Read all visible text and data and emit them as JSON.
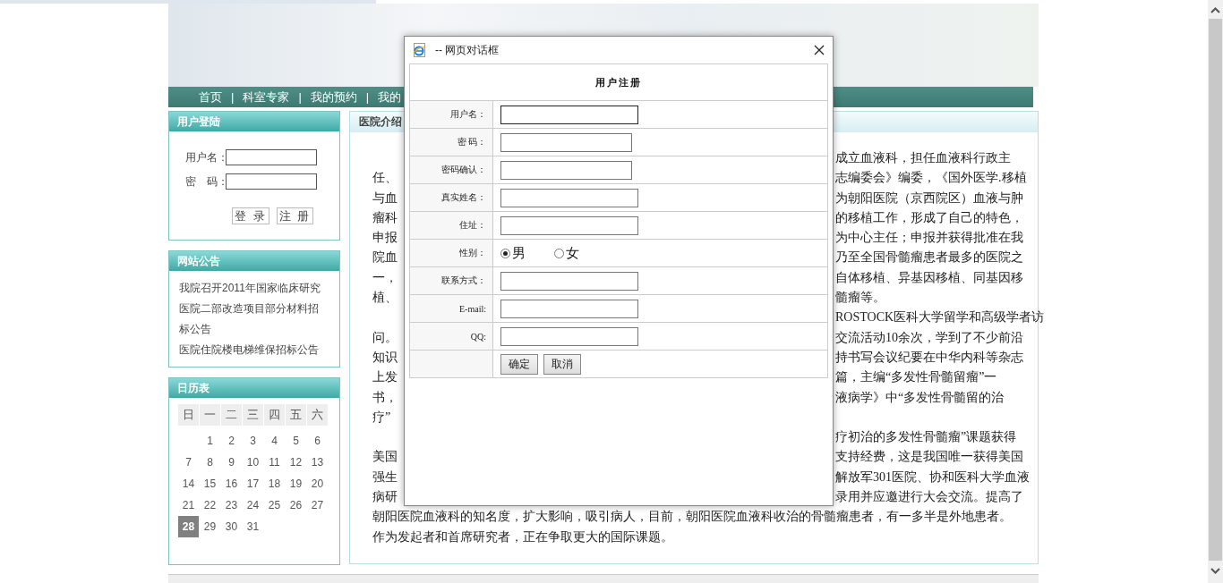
{
  "nav": [
    {
      "kind": "link",
      "label": "首页"
    },
    {
      "kind": "separator",
      "label": "|"
    },
    {
      "kind": "link",
      "label": "科室专家"
    },
    {
      "kind": "separator",
      "label": "|"
    },
    {
      "kind": "link",
      "label": "我的预约"
    },
    {
      "kind": "separator",
      "label": "|"
    },
    {
      "kind": "link",
      "label": "我的"
    }
  ],
  "login": {
    "title": "用户登陆",
    "fields": [
      {
        "label": "用户名："
      },
      {
        "label": "密　码："
      }
    ],
    "buttons": [
      "登 录",
      "注 册"
    ]
  },
  "notices": {
    "title": "网站公告",
    "items": [
      "我院召开2011年国家临床研究",
      "医院二部改造项目部分材料招标公告",
      "医院住院楼电梯维保招标公告"
    ]
  },
  "calendar": {
    "title": "日历表",
    "weekdays": [
      "日",
      "一",
      "二",
      "三",
      "四",
      "五",
      "六"
    ],
    "weeks": [
      {
        "days": [
          {
            "day": "1",
            "selected": false
          },
          {
            "day": "2",
            "selected": false
          },
          {
            "day": "3",
            "selected": false
          },
          {
            "day": "4",
            "selected": false
          },
          {
            "day": "5",
            "selected": false
          },
          {
            "day": "6",
            "selected": false
          }
        ]
      },
      {
        "days": [
          {
            "day": "7",
            "selected": false
          },
          {
            "day": "8",
            "selected": false
          },
          {
            "day": "9",
            "selected": false
          },
          {
            "day": "10",
            "selected": false
          },
          {
            "day": "11",
            "selected": false
          },
          {
            "day": "12",
            "selected": false
          },
          {
            "day": "13",
            "selected": false
          }
        ]
      },
      {
        "days": [
          {
            "day": "14",
            "selected": false
          },
          {
            "day": "15",
            "selected": false
          },
          {
            "day": "16",
            "selected": false
          },
          {
            "day": "17",
            "selected": false
          },
          {
            "day": "18",
            "selected": false
          },
          {
            "day": "19",
            "selected": false
          },
          {
            "day": "20",
            "selected": false
          }
        ]
      },
      {
        "days": [
          {
            "day": "21",
            "selected": false
          },
          {
            "day": "22",
            "selected": false
          },
          {
            "day": "23",
            "selected": false
          },
          {
            "day": "24",
            "selected": false
          },
          {
            "day": "25",
            "selected": false
          },
          {
            "day": "26",
            "selected": false
          },
          {
            "day": "27",
            "selected": false
          }
        ]
      },
      {
        "days": [
          {
            "day": "28",
            "selected": true
          },
          {
            "day": "29",
            "selected": false
          },
          {
            "day": "30",
            "selected": false
          },
          {
            "day": "31",
            "selected": false
          }
        ]
      }
    ]
  },
  "article": {
    "title": "医院介绍",
    "lines": [
      {
        "kind": "split",
        "end": "成立血液科，担任血液科行政主"
      },
      {
        "kind": "split",
        "start": "任、",
        "end": "志编委会》编委，《国外医学.移植"
      },
      {
        "kind": "split",
        "start": "与血",
        "end": "为朝阳医院（京西院区）血液与肿"
      },
      {
        "kind": "split",
        "start": "瘤科",
        "end": "的移植工作，形成了自己的特色，"
      },
      {
        "kind": "split",
        "start": "申报",
        "end": "为中心主任；申报并获得批准在我"
      },
      {
        "kind": "split",
        "start": "院血",
        "end": "乃至全国骨髓瘤患者最多的医院之"
      },
      {
        "kind": "split",
        "start": "一，",
        "end": "自体移植、异基因移植、同基因移"
      },
      {
        "kind": "split",
        "start": "植、",
        "end": "髓瘤等。"
      },
      {
        "kind": "split",
        "end": "ROSTOCK医科大学留学和高级学者访"
      },
      {
        "kind": "split",
        "start": "问。",
        "end": "交流活动10余次，学到了不少前沿"
      },
      {
        "kind": "split",
        "start": "知识",
        "end": "持书写会议纪要在中华内科等杂志"
      },
      {
        "kind": "split",
        "start": "上发",
        "end": "篇，主编“多发性骨髓留瘤”一"
      },
      {
        "kind": "split",
        "start": "书，",
        "end": "液病学》中“多发性骨髓留的治"
      },
      {
        "kind": "split",
        "start": "疗”"
      },
      {
        "kind": "split",
        "end": "疗初治的多发性骨髓瘤”课题获得"
      },
      {
        "kind": "split",
        "start": "美国",
        "end": "支持经费，这是我国唯一获得美国"
      },
      {
        "kind": "split",
        "start": "强生",
        "end": "解放军301医院、协和医科大学血液"
      },
      {
        "kind": "split",
        "start": "病研",
        "end": "录用并应邀进行大会交流。提高了"
      },
      {
        "kind": "full",
        "text": "朝阳医院血液科的知名度，扩大影响，吸引病人，目前，朝阳医院血液科收治的骨髓瘤患者，有一多半是外地患者。"
      },
      {
        "kind": "full",
        "text": "作为发起者和首席研究者，正在争取更大的国际课题。"
      }
    ]
  },
  "dialog": {
    "title": "-- 网页对话框",
    "form_title": "用户注册",
    "rows": [
      {
        "kind": "text",
        "label": "用户名：",
        "focused": true
      },
      {
        "kind": "password",
        "label": "密 码：",
        "focused": false
      },
      {
        "kind": "password",
        "label": "密码确认：",
        "focused": false
      },
      {
        "kind": "text",
        "label": "真实姓名：",
        "focused": false
      },
      {
        "kind": "text",
        "label": "住址：",
        "focused": false
      },
      {
        "kind": "radio",
        "label": "性别：",
        "options": [
          {
            "label": "男",
            "selected": true
          },
          {
            "label": "女",
            "selected": false
          }
        ]
      },
      {
        "kind": "text",
        "label": "联系方式：",
        "focused": false
      },
      {
        "kind": "text",
        "label": "E-mail:",
        "focused": false
      },
      {
        "kind": "text",
        "label": "QQ:",
        "focused": false
      }
    ],
    "buttons": [
      "确定",
      "取消"
    ]
  }
}
